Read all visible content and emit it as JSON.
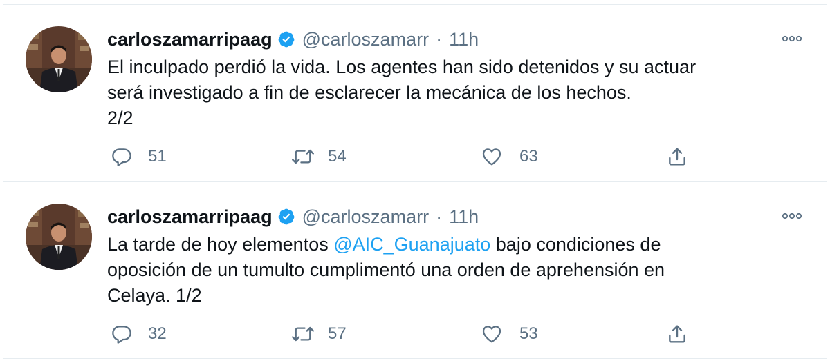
{
  "tweets": [
    {
      "display_name": "carloszamarripaag",
      "handle": "@carloszamarr",
      "separator": "·",
      "time": "11h",
      "text_lines": [
        "El inculpado perdió la vida. Los agentes han sido detenidos y su actuar",
        "será investigado a fin de esclarecer la mecánica de los hechos.",
        "2/2"
      ],
      "replies": "51",
      "retweets": "54",
      "likes": "63"
    },
    {
      "display_name": "carloszamarripaag",
      "handle": "@carloszamarr",
      "separator": "·",
      "time": "11h",
      "text_line1_before": "La tarde de hoy elementos ",
      "text_line1_mention": "@AIC_Guanajuato",
      "text_line1_after": " bajo condiciones de",
      "text_lines_rest": [
        "oposición de un tumulto cumplimentó una orden de aprehensión en",
        "Celaya. 1/2"
      ],
      "replies": "32",
      "retweets": "57",
      "likes": "53"
    }
  ],
  "icons": {
    "verified": "verified-badge-icon",
    "more": "more-options-icon",
    "reply": "reply-icon",
    "retweet": "retweet-icon",
    "like": "heart-icon",
    "share": "share-icon"
  },
  "colors": {
    "verified": "#1da1f2",
    "mention": "#1da1f2",
    "secondary_text": "#5b7083",
    "divider": "#e6ecf0"
  }
}
